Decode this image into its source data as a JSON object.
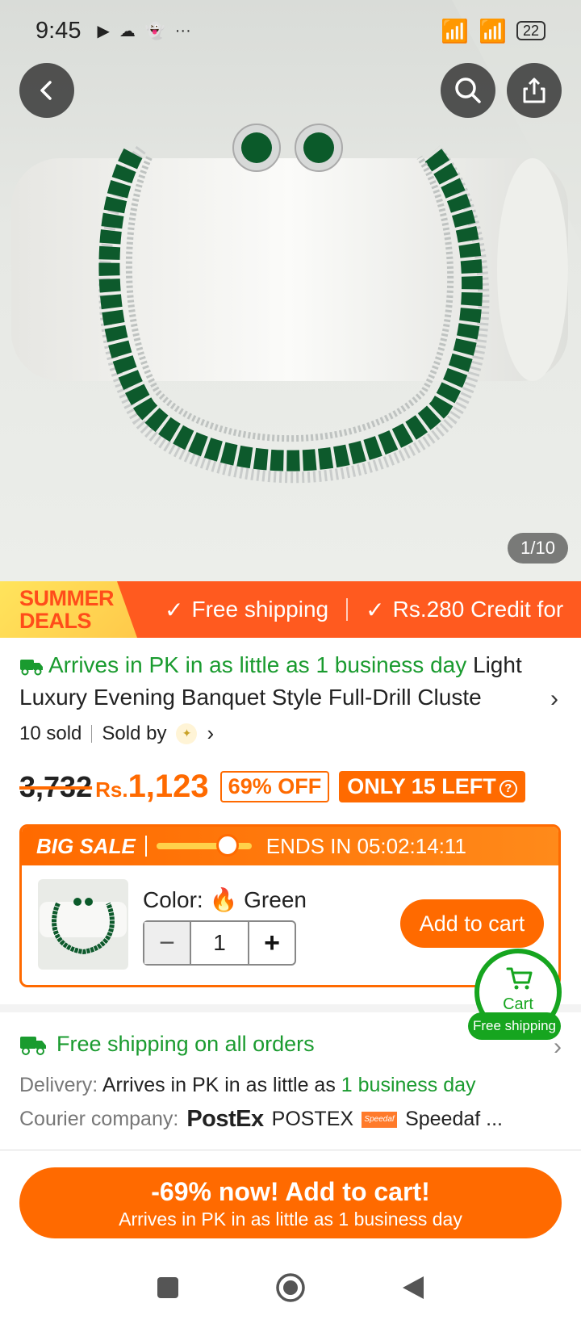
{
  "status_bar": {
    "time": "9:45",
    "battery": "22"
  },
  "gallery": {
    "page_indicator": "1/10"
  },
  "promo_banner": {
    "summer_line1": "SUMMER",
    "summer_line2": "DEALS",
    "item1": "Free shipping",
    "item2": "Rs.280 Credit for"
  },
  "product": {
    "arrival_badge": "Arrives in PK in as little as 1 business day",
    "title_part1": "Light",
    "title_line2": "Luxury Evening Banquet Style Full-Drill Cluste",
    "sold": "10 sold",
    "sold_by": "Sold by"
  },
  "price": {
    "old": "3,732",
    "currency": "Rs.",
    "current": "1,123",
    "discount": "69% OFF",
    "stock": "ONLY 15 LEFT"
  },
  "sale": {
    "label": "BIG SALE",
    "ends_in": "ENDS IN 05:02:14:11",
    "progress": 0.75,
    "color_label": "Color:",
    "color_value": "Green",
    "quantity": "1",
    "add_to_cart": "Add to cart"
  },
  "cart_fab": {
    "label": "Cart",
    "pill": "Free shipping"
  },
  "shipping": {
    "title": "Free shipping on all orders",
    "delivery_label": "Delivery:",
    "delivery_text": "Arrives in PK in as little as",
    "delivery_highlight": "1 business day",
    "courier_label": "Courier company:",
    "courier1_logo": "PostEx",
    "courier1": "POSTEX",
    "courier2_logo": "Speedaf",
    "courier2": "Speedaf ..."
  },
  "cta": {
    "main": "-69% now! Add to cart!",
    "sub": "Arrives in PK in as little as 1 business day"
  },
  "colors": {
    "accent": "#ff6a00",
    "success": "#1a9b2f",
    "promo": "#ff5a1f"
  }
}
